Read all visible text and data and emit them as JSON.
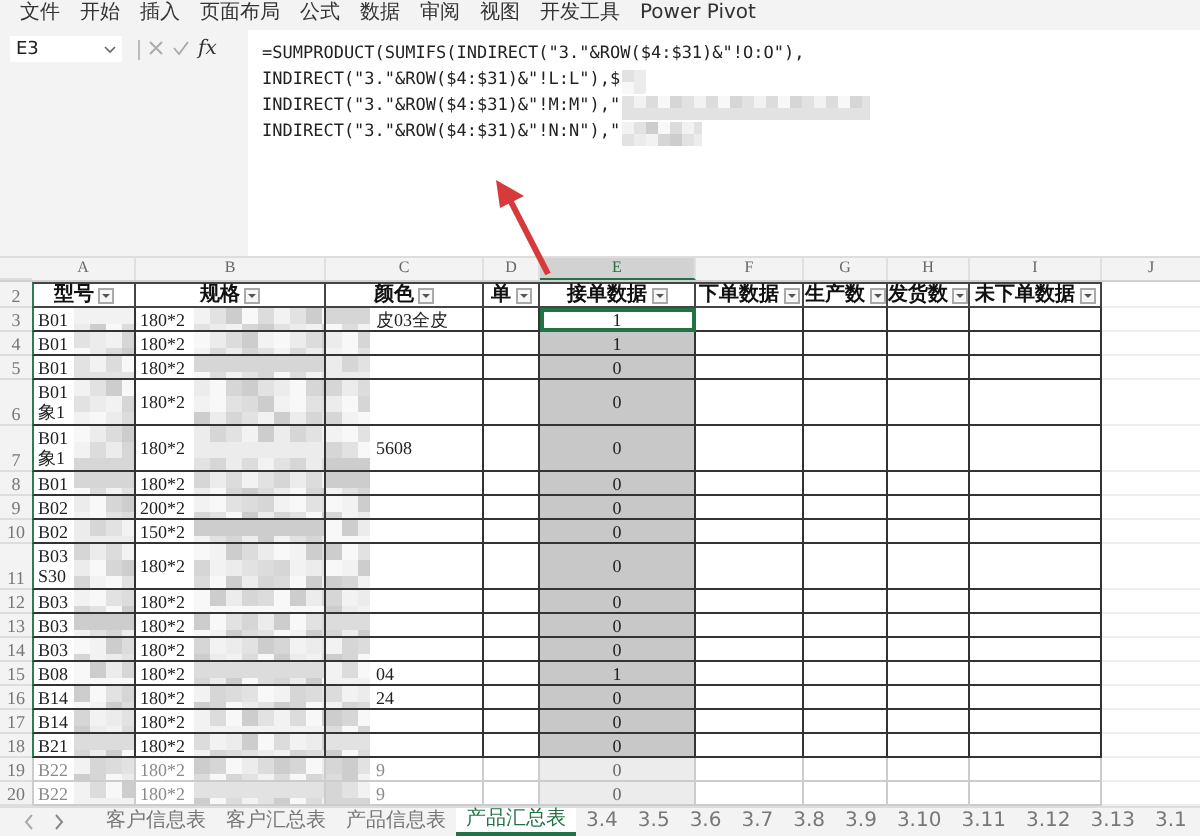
{
  "ribbon_tabs": [
    "文件",
    "开始",
    "插入",
    "页面布局",
    "公式",
    "数据",
    "审阅",
    "视图",
    "开发工具",
    "Power Pivot"
  ],
  "name_box": "E3",
  "formula_function_label": "fx",
  "formula_lines": [
    {
      "text": "=SUMPRODUCT(SUMIFS(INDIRECT(\"3.\"&ROW($4:$31)&\"!O:O\"),",
      "redacted": false
    },
    {
      "text": "INDIRECT(\"3.\"&ROW($4:$31)&\"!L:L\"),$",
      "redacted": true
    },
    {
      "text": "INDIRECT(\"3.\"&ROW($4:$31)&\"!M:M\"),\"",
      "redacted": true
    },
    {
      "text": "INDIRECT(\"3.\"&ROW($4:$31)&\"!N:N\"),\"",
      "redacted": true
    }
  ],
  "columns": [
    {
      "letter": "A",
      "selected": false
    },
    {
      "letter": "B",
      "selected": false
    },
    {
      "letter": "C",
      "selected": false
    },
    {
      "letter": "D",
      "selected": false
    },
    {
      "letter": "E",
      "selected": true
    },
    {
      "letter": "F",
      "selected": false
    },
    {
      "letter": "G",
      "selected": false
    },
    {
      "letter": "H",
      "selected": false
    },
    {
      "letter": "I",
      "selected": false
    },
    {
      "letter": "J",
      "selected": false
    }
  ],
  "header_row_number": "2",
  "headers": [
    "型号",
    "规格",
    "颜色",
    "单",
    "接单数据",
    "下单数据",
    "生产数",
    "发货数",
    "未下单数据"
  ],
  "rows": [
    {
      "number": "3",
      "model": [
        "B01"
      ],
      "spec": "180*2",
      "variant": "皮03全皮",
      "quantity": "1",
      "active": true,
      "dimmed": false
    },
    {
      "number": "4",
      "model": [
        "B01"
      ],
      "spec": "180*2",
      "quantity": "1",
      "active": false,
      "dimmed": false
    },
    {
      "number": "5",
      "model": [
        "B01"
      ],
      "spec": "180*2",
      "quantity": "0",
      "active": false,
      "dimmed": false
    },
    {
      "number": "6",
      "model": [
        "B01",
        "象1"
      ],
      "spec": "180*2",
      "quantity": "0",
      "active": false,
      "dimmed": false
    },
    {
      "number": "7",
      "model": [
        "B01",
        "象1"
      ],
      "spec": "180*2",
      "variant": "5608",
      "quantity": "0",
      "active": false,
      "dimmed": false
    },
    {
      "number": "8",
      "model": [
        "B01"
      ],
      "spec": "180*2",
      "quantity": "0",
      "active": false,
      "dimmed": false
    },
    {
      "number": "9",
      "model": [
        "B02"
      ],
      "spec": "200*2",
      "quantity": "0",
      "active": false,
      "dimmed": false
    },
    {
      "number": "10",
      "model": [
        "B02"
      ],
      "spec": "150*2",
      "quantity": "0",
      "active": false,
      "dimmed": false
    },
    {
      "number": "11",
      "model": [
        "B03",
        "S30"
      ],
      "spec": "180*2",
      "quantity": "0",
      "active": false,
      "dimmed": false
    },
    {
      "number": "12",
      "model": [
        "B03"
      ],
      "spec": "180*2",
      "quantity": "0",
      "active": false,
      "dimmed": false
    },
    {
      "number": "13",
      "model": [
        "B03"
      ],
      "spec": "180*2",
      "quantity": "0",
      "active": false,
      "dimmed": false
    },
    {
      "number": "14",
      "model": [
        "B03"
      ],
      "spec": "180*2",
      "quantity": "0",
      "active": false,
      "dimmed": false
    },
    {
      "number": "15",
      "model": [
        "B08"
      ],
      "spec": "180*2",
      "variant": "04",
      "quantity": "1",
      "active": false,
      "dimmed": false
    },
    {
      "number": "16",
      "model": [
        "B14"
      ],
      "spec": "180*2",
      "variant": "24",
      "quantity": "0",
      "active": false,
      "dimmed": false
    },
    {
      "number": "17",
      "model": [
        "B14"
      ],
      "spec": "180*2",
      "quantity": "0",
      "active": false,
      "dimmed": false
    },
    {
      "number": "18",
      "model": [
        "B21"
      ],
      "spec": "180*2",
      "quantity": "0",
      "active": false,
      "dimmed": false
    },
    {
      "number": "19",
      "model": [
        "B22"
      ],
      "spec": "180*2",
      "variant": "9",
      "quantity": "0",
      "active": false,
      "dimmed": true
    },
    {
      "number": "20",
      "model": [
        "B22"
      ],
      "spec": "180*2",
      "variant": "9",
      "quantity": "0",
      "active": false,
      "dimmed": true
    }
  ],
  "sheet_tabs": [
    {
      "label": "客户信息表",
      "selected": false
    },
    {
      "label": "客户汇总表",
      "selected": false
    },
    {
      "label": "产品信息表",
      "selected": false
    },
    {
      "label": "产品汇总表",
      "selected": true
    },
    {
      "label": "3.4",
      "selected": false
    },
    {
      "label": "3.5",
      "selected": false
    },
    {
      "label": "3.6",
      "selected": false
    },
    {
      "label": "3.7",
      "selected": false
    },
    {
      "label": "3.8",
      "selected": false
    },
    {
      "label": "3.9",
      "selected": false
    },
    {
      "label": "3.10",
      "selected": false
    },
    {
      "label": "3.11",
      "selected": false
    },
    {
      "label": "3.12",
      "selected": false
    },
    {
      "label": "3.13",
      "selected": false
    },
    {
      "label": "3.1",
      "selected": false
    }
  ]
}
